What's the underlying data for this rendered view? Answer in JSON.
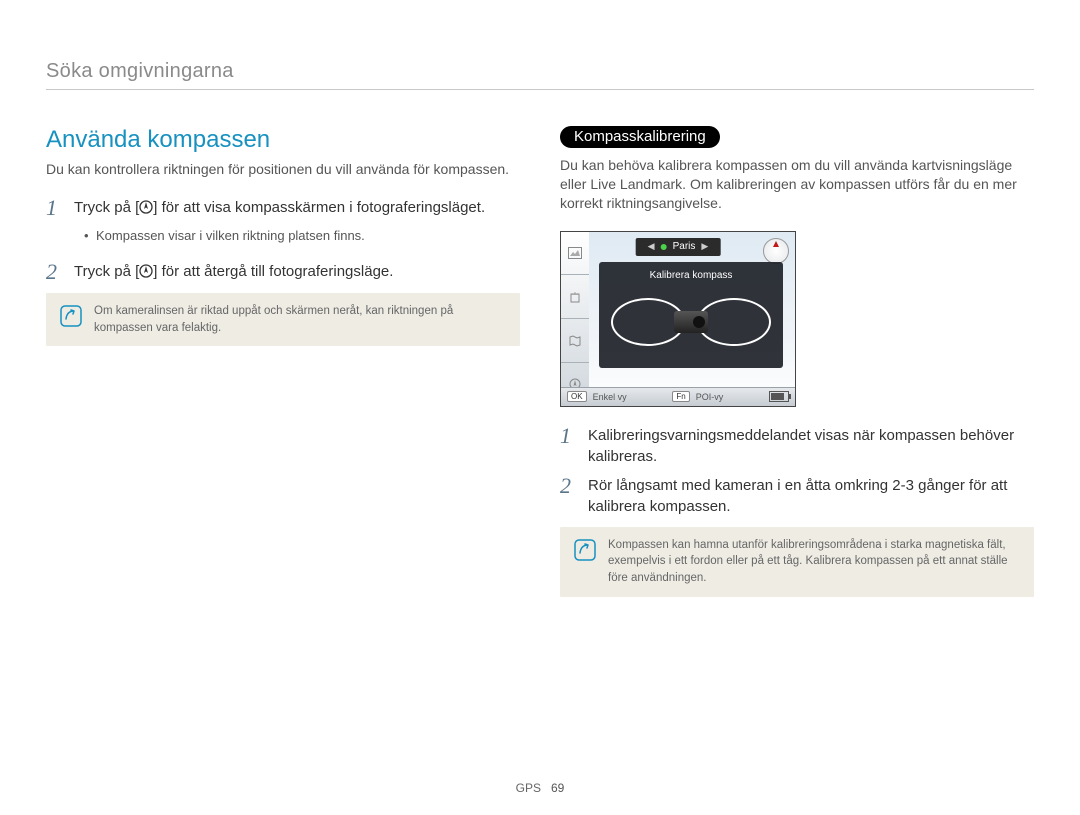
{
  "breadcrumb": "Söka omgivningarna",
  "left": {
    "heading": "Använda kompassen",
    "intro": "Du kan kontrollera riktningen för positionen du vill använda för kompassen.",
    "step1": {
      "num": "1",
      "pre": "Tryck på [",
      "post": "] för att visa kompasskärmen i fotograferingsläget."
    },
    "bullet1": "Kompassen visar i vilken riktning platsen finns.",
    "step2": {
      "num": "2",
      "pre": "Tryck på [",
      "post": "] för att återgå till fotograferingsläge."
    },
    "note": "Om kameralinsen är riktad uppåt och skärmen neråt, kan riktningen på kompassen vara felaktig."
  },
  "right": {
    "pill": "Kompasskalibrering",
    "intro": "Du kan behöva kalibrera kompassen om du vill använda kartvisningsläge eller Live Landmark. Om kalibreringen av kompassen utförs får du en mer korrekt riktningsangivelse.",
    "screen": {
      "location": "Paris",
      "overlay_title": "Kalibrera kompass",
      "bottom_left_key": "OK",
      "bottom_left_label": "Enkel vy",
      "bottom_right_key": "Fn",
      "bottom_right_label": "POI-vy"
    },
    "step1": {
      "num": "1",
      "text": "Kalibreringsvarningsmeddelandet visas när kompassen behöver kalibreras."
    },
    "step2": {
      "num": "2",
      "text": "Rör långsamt med kameran i en åtta omkring 2-3 gånger för att kalibrera kompassen."
    },
    "note": "Kompassen kan hamna utanför kalibreringsområdena i starka magnetiska fält, exempelvis i ett fordon eller på ett tåg. Kalibrera kompassen på ett annat ställe före användningen."
  },
  "footer": {
    "label": "GPS",
    "page": "69"
  }
}
